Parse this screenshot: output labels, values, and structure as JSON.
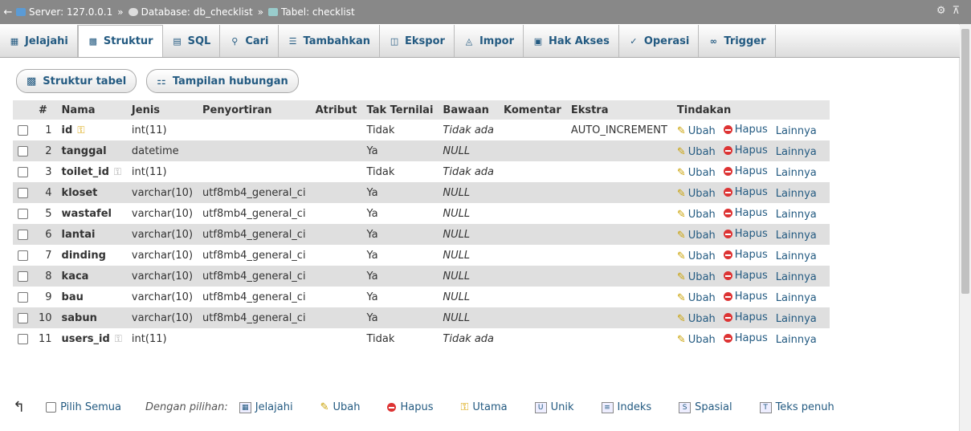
{
  "breadcrumb": {
    "server": "Server: 127.0.0.1",
    "database": "Database: db_checklist",
    "table": "Tabel: checklist",
    "separator": "»"
  },
  "tabs": [
    {
      "label": "Jelajahi",
      "icon": "browse-icon"
    },
    {
      "label": "Struktur",
      "icon": "structure-icon",
      "active": true
    },
    {
      "label": "SQL",
      "icon": "sql-icon"
    },
    {
      "label": "Cari",
      "icon": "search-icon"
    },
    {
      "label": "Tambahkan",
      "icon": "insert-icon"
    },
    {
      "label": "Ekspor",
      "icon": "export-icon"
    },
    {
      "label": "Impor",
      "icon": "import-icon"
    },
    {
      "label": "Hak Akses",
      "icon": "privileges-icon"
    },
    {
      "label": "Operasi",
      "icon": "wrench-icon"
    },
    {
      "label": "Trigger",
      "icon": "trigger-icon"
    }
  ],
  "subtabs": {
    "structure": "Struktur tabel",
    "relation": "Tampilan hubungan"
  },
  "table": {
    "headers": [
      "#",
      "Nama",
      "Jenis",
      "Penyortiran",
      "Atribut",
      "Tak Ternilai",
      "Bawaan",
      "Komentar",
      "Ekstra",
      "Tindakan"
    ],
    "rows": [
      {
        "num": "1",
        "name": "id",
        "key": "primary",
        "type": "int(11)",
        "collation": "",
        "attr": "",
        "null": "Tidak",
        "default": "Tidak ada",
        "comment": "",
        "extra": "AUTO_INCREMENT"
      },
      {
        "num": "2",
        "name": "tanggal",
        "key": "",
        "type": "datetime",
        "collation": "",
        "attr": "",
        "null": "Ya",
        "default": "NULL",
        "comment": "",
        "extra": ""
      },
      {
        "num": "3",
        "name": "toilet_id",
        "key": "index",
        "type": "int(11)",
        "collation": "",
        "attr": "",
        "null": "Tidak",
        "default": "Tidak ada",
        "comment": "",
        "extra": ""
      },
      {
        "num": "4",
        "name": "kloset",
        "key": "",
        "type": "varchar(10)",
        "collation": "utf8mb4_general_ci",
        "attr": "",
        "null": "Ya",
        "default": "NULL",
        "comment": "",
        "extra": ""
      },
      {
        "num": "5",
        "name": "wastafel",
        "key": "",
        "type": "varchar(10)",
        "collation": "utf8mb4_general_ci",
        "attr": "",
        "null": "Ya",
        "default": "NULL",
        "comment": "",
        "extra": ""
      },
      {
        "num": "6",
        "name": "lantai",
        "key": "",
        "type": "varchar(10)",
        "collation": "utf8mb4_general_ci",
        "attr": "",
        "null": "Ya",
        "default": "NULL",
        "comment": "",
        "extra": ""
      },
      {
        "num": "7",
        "name": "dinding",
        "key": "",
        "type": "varchar(10)",
        "collation": "utf8mb4_general_ci",
        "attr": "",
        "null": "Ya",
        "default": "NULL",
        "comment": "",
        "extra": ""
      },
      {
        "num": "8",
        "name": "kaca",
        "key": "",
        "type": "varchar(10)",
        "collation": "utf8mb4_general_ci",
        "attr": "",
        "null": "Ya",
        "default": "NULL",
        "comment": "",
        "extra": ""
      },
      {
        "num": "9",
        "name": "bau",
        "key": "",
        "type": "varchar(10)",
        "collation": "utf8mb4_general_ci",
        "attr": "",
        "null": "Ya",
        "default": "NULL",
        "comment": "",
        "extra": ""
      },
      {
        "num": "10",
        "name": "sabun",
        "key": "",
        "type": "varchar(10)",
        "collation": "utf8mb4_general_ci",
        "attr": "",
        "null": "Ya",
        "default": "NULL",
        "comment": "",
        "extra": ""
      },
      {
        "num": "11",
        "name": "users_id",
        "key": "index",
        "type": "int(11)",
        "collation": "",
        "attr": "",
        "null": "Tidak",
        "default": "Tidak ada",
        "comment": "",
        "extra": ""
      }
    ],
    "actions": {
      "edit": "Ubah",
      "delete": "Hapus",
      "more": "Lainnya"
    }
  },
  "footer": {
    "check_all": "Pilih Semua",
    "with_selected": "Dengan pilihan:",
    "actions": [
      {
        "label": "Jelajahi",
        "icon": "browse-icon"
      },
      {
        "label": "Ubah",
        "icon": "pencil-icon"
      },
      {
        "label": "Hapus",
        "icon": "delete-icon"
      },
      {
        "label": "Utama",
        "icon": "primary-key-icon"
      },
      {
        "label": "Unik",
        "icon": "unique-icon"
      },
      {
        "label": "Indeks",
        "icon": "index-icon"
      },
      {
        "label": "Spasial",
        "icon": "spatial-icon"
      },
      {
        "label": "Teks penuh",
        "icon": "fulltext-icon"
      }
    ]
  },
  "colors": {
    "link": "#235a81",
    "topbar": "#888888",
    "row_alt": "#dfdfdf"
  }
}
